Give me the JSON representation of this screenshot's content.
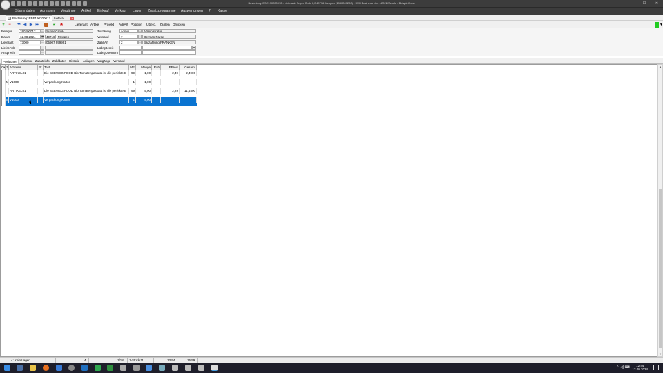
{
  "window": {
    "title": "Bestellung: EBE190200012 - Lieferant: Super GmbH, D49716 Meppen (1980007200) - XXX Business Line - 2022/Schulz - Beispielfirma",
    "controls": [
      "—",
      "☐",
      "✕"
    ]
  },
  "menu": [
    "Stammdaten",
    "Adressen",
    "Vorgänge",
    "Artikel",
    "Einkauf",
    "Verkauf",
    "Lager",
    "Zusatzprogramme",
    "Auswertungen",
    "?",
    "Kasse"
  ],
  "doc_tabs": {
    "tab1": "Bestellung: EBE190200012",
    "tab2": "Liefera...",
    "close": "x"
  },
  "toolbar": {
    "icons": {
      "new": "+",
      "delete": "−",
      "first": "⏮",
      "prev": "◀",
      "next": "▶",
      "last": "⏭",
      "save": "✔",
      "cancel": "✖"
    },
    "links": [
      "Lieferant",
      "Artikel",
      "Projekt",
      "AdrArt",
      "Position",
      "Überg.",
      "Zahlen",
      "Drucken"
    ]
  },
  "form": {
    "left": {
      "belegnr_label": "Belegnr",
      "belegnr": "190200012",
      "belegnr_name": "Super GmbH",
      "datum_label": "Datum",
      "datum": "12.08.2024",
      "plz": "49716",
      "ort": "Meppen",
      "lieferant_label": "Lieferant",
      "lieferant": "73000",
      "telefon": "05907 999991",
      "lieferadr_label": "Liefer.Adr",
      "lieferadr": "",
      "ansprech_label": "Ansprech",
      "ansprech": ""
    },
    "right": {
      "zustaendig_label": "Zuständig",
      "zustaendig": "admin",
      "zustaendig_name": "Administrator",
      "versand_label": "Versand",
      "versand": "7",
      "versand_name": "German Parcel",
      "zahlart_label": "Zahl.Art",
      "zahlart": "2",
      "zahlart_name": "Barzahlung FRANKEN",
      "lbrgbereit_label": "LübrgBereit",
      "lbrgbereit": "",
      "lbrguebernom_label": "LübrgUbernom",
      "lbrguebernom": ""
    }
  },
  "sub_tabs": [
    "Positionen",
    "Adresse",
    "Zusatzinfo",
    "Zahldaten",
    "Historie",
    "Anlagen",
    "Vorgänge",
    "Versand"
  ],
  "grid": {
    "headers": [
      "Ok",
      "Z",
      "Artikelnr",
      "Pr",
      "Text",
      "ME",
      "Menge",
      "Rab",
      "EPreis",
      "Gesamt"
    ],
    "rows": [
      {
        "z": "",
        "artikelnr": "ARTIKEL01",
        "text": "Die SEEWEG FOOD Bio-Tomatenpassata ist die perfekte B",
        "me": "99",
        "menge": "1,00",
        "rab": "",
        "epreis": "2,49",
        "gesamt": "2,4900"
      },
      {
        "z": "M",
        "artikelnr": "V1000",
        "text": "Verpackung Karton",
        "me": "1",
        "menge": "1,00",
        "rab": "",
        "epreis": "",
        "gesamt": ""
      },
      {
        "z": "",
        "artikelnr": "ARTIKEL01",
        "text": "Die SEEWEG FOOD Bio-Tomatenpassata ist die perfekte B",
        "me": "99",
        "menge": "5,00",
        "rab": "",
        "epreis": "2,29",
        "gesamt": "11,4500"
      },
      {
        "z": "M",
        "artikelnr": "V1000",
        "text": "Verpackung Karton",
        "me": "1",
        "menge": "5,00",
        "rab": "",
        "epreis": "",
        "gesamt": ""
      }
    ]
  },
  "status": {
    "lager": "4: Kein Lager",
    "count": "4",
    "pos": "1/18",
    "stueck": "1-Stück  *1",
    "sum1": "13,94",
    "sum2": "16,59"
  },
  "taskbar": {
    "time": "12:44",
    "date": "12.08.2024",
    "tray": "⌃ ◁) ⌨"
  },
  "colors": {
    "selection": "#0a74d1",
    "title_bg": "#3c3c3c",
    "indicator": "#22cc22"
  }
}
